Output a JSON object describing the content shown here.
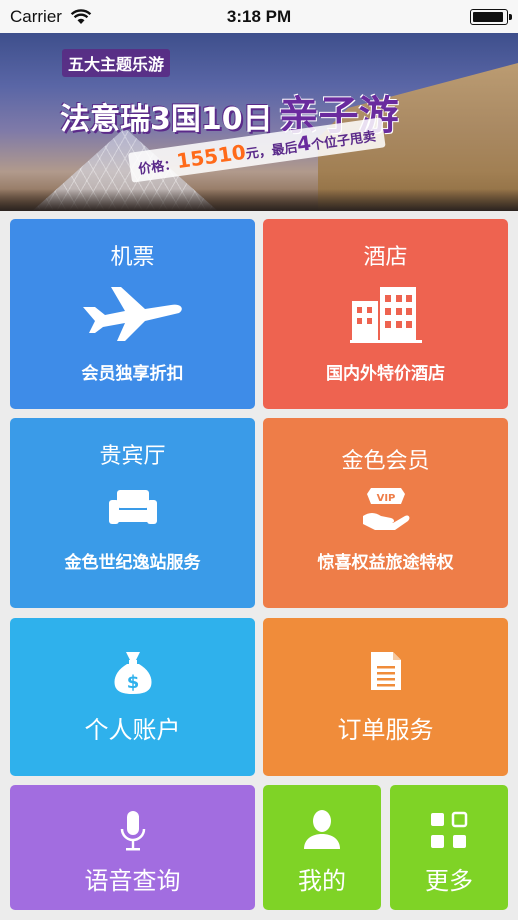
{
  "status_bar": {
    "carrier": "Carrier",
    "time": "3:18 PM"
  },
  "banner": {
    "tag": "五大主题乐游",
    "headline": "法意瑞3国10日",
    "headline_emphasis": "亲子游",
    "price_label": "价格：",
    "price_value": "15510",
    "price_suffix": "元，最后",
    "seats_value": "4",
    "seats_suffix": "个位子甩卖",
    "page_count": 2,
    "active_page": 2
  },
  "tiles": {
    "flights": {
      "title": "机票",
      "subtitle": "会员独享折扣",
      "icon": "airplane-icon",
      "color": "#3e8ce8"
    },
    "hotels": {
      "title": "酒店",
      "subtitle": "国内外特价酒店",
      "icon": "buildings-icon",
      "color": "#ee6350"
    },
    "lounge": {
      "title": "贵宾厅",
      "subtitle": "金色世纪逸站服务",
      "icon": "sofa-icon",
      "color": "#3a9be8"
    },
    "gold_member": {
      "title": "金色会员",
      "subtitle": "惊喜权益旅途特权",
      "icon": "vip-hand-icon",
      "color": "#ee7d48"
    },
    "account": {
      "title": "个人账户",
      "icon": "money-bag-icon",
      "color": "#2fb1ec"
    },
    "orders": {
      "title": "订单服务",
      "icon": "document-icon",
      "color": "#f08c3a"
    },
    "voice_search": {
      "title": "语音查询",
      "icon": "microphone-icon",
      "color": "#a26de0"
    },
    "mine": {
      "title": "我的",
      "icon": "user-icon",
      "color": "#7fd326"
    },
    "more": {
      "title": "更多",
      "icon": "grid-icon",
      "color": "#7fd326"
    }
  }
}
